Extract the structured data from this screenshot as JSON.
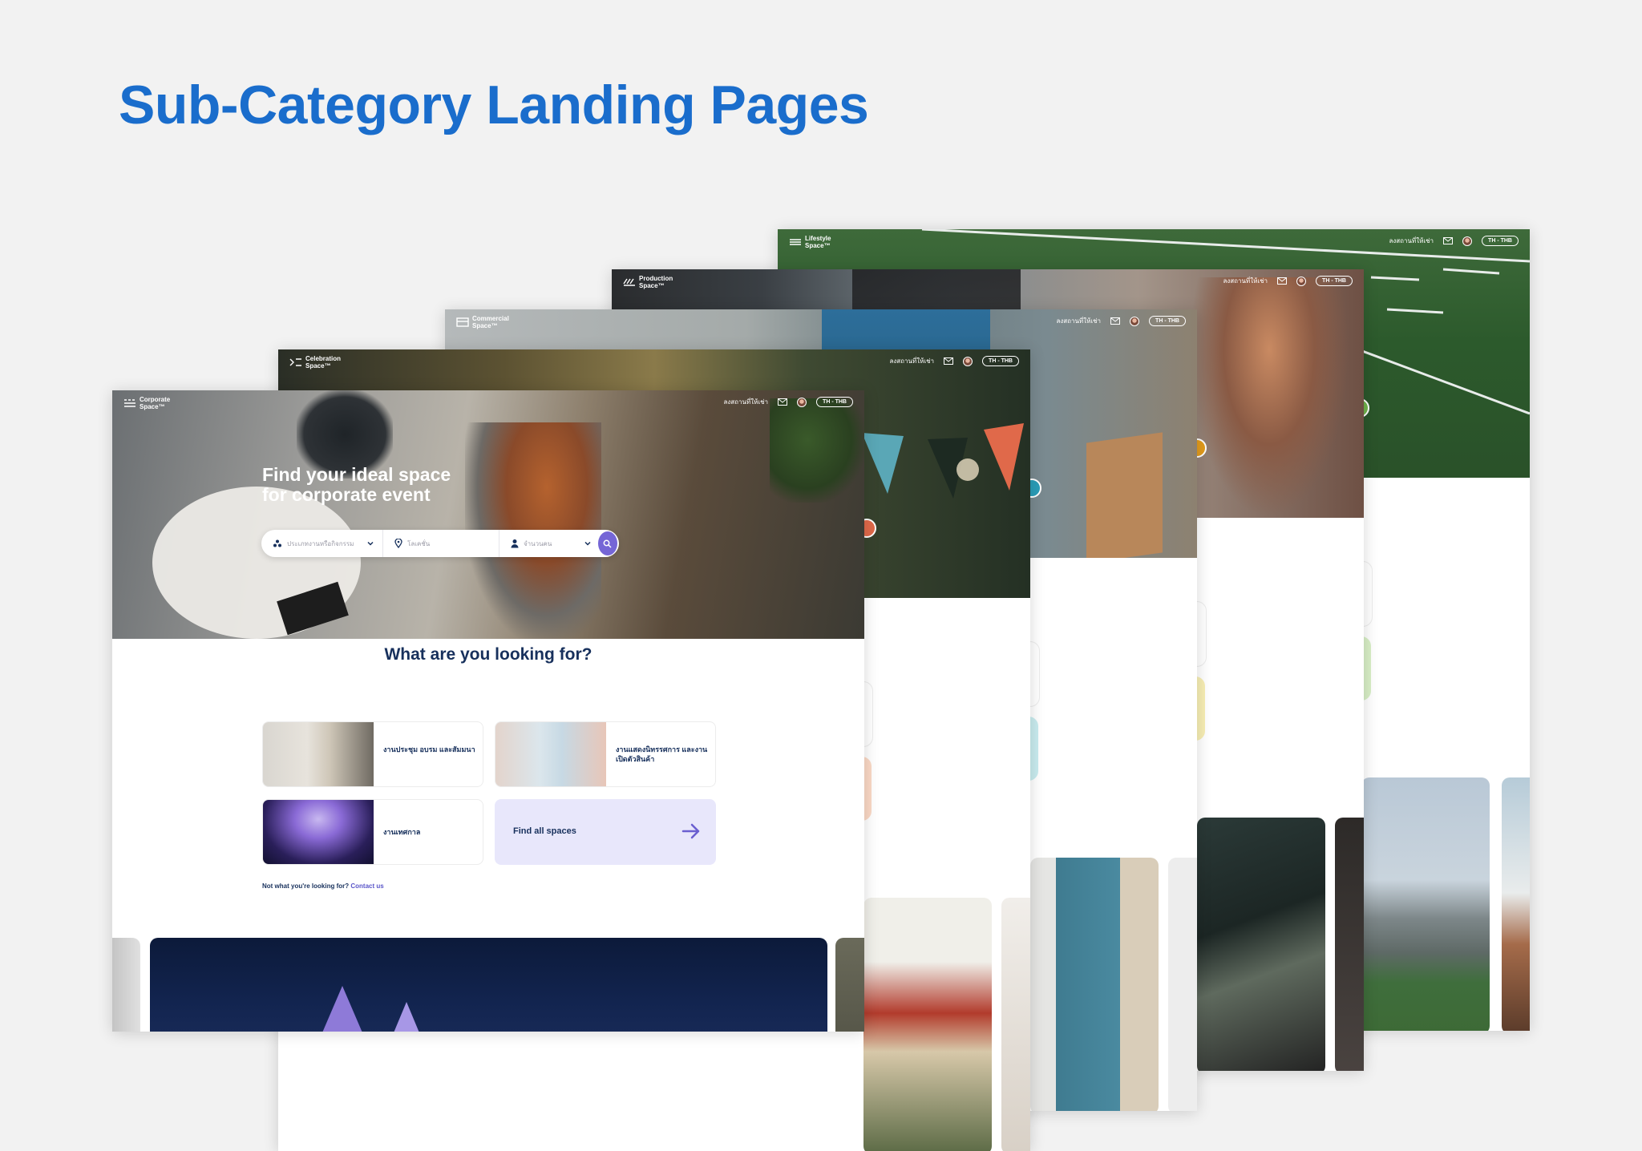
{
  "headline": "Sub-Category Landing Pages",
  "colors": {
    "headline": "#1a6dcc",
    "accent": "#7566d6",
    "navy": "#17305c",
    "find_all_bg": "#e8e7fb"
  },
  "nav": {
    "list_space": "ลงสถานที่ให้เช่า",
    "lang": "TH - THB",
    "mail_icon": "mail-icon",
    "avatar": "user-avatar"
  },
  "cards": {
    "lifestyle": {
      "logo_line1": "Lifestyle",
      "logo_line2": "Space™"
    },
    "production": {
      "logo_line1": "Production",
      "logo_line2": "Space™"
    },
    "commercial": {
      "logo_line1": "Commercial",
      "logo_line2": "Space™"
    },
    "celebration": {
      "logo_line1": "Celebration",
      "logo_line2": "Space™"
    },
    "corporate": {
      "logo_line1": "Corporate",
      "logo_line2": "Space™",
      "hero_title_line1": "Find your ideal space",
      "hero_title_line2": "for corporate event",
      "search": {
        "category_placeholder": "ประเภทงานหรือกิจกรรม",
        "location_placeholder": "โลเคชั่น",
        "guests_placeholder": "จำนวนคน",
        "search_icon": "search-icon"
      },
      "section_title": "What are you looking for?",
      "categories": [
        {
          "label": "งานประชุม อบรม และสัมมนา"
        },
        {
          "label": "งานแสดงนิทรรศการ และงานเปิดตัวสินค้า"
        },
        {
          "label": "งานเทศกาล"
        }
      ],
      "find_all": "Find all spaces",
      "help_text": "Not what you're looking for?",
      "help_link": "Contact us"
    }
  }
}
